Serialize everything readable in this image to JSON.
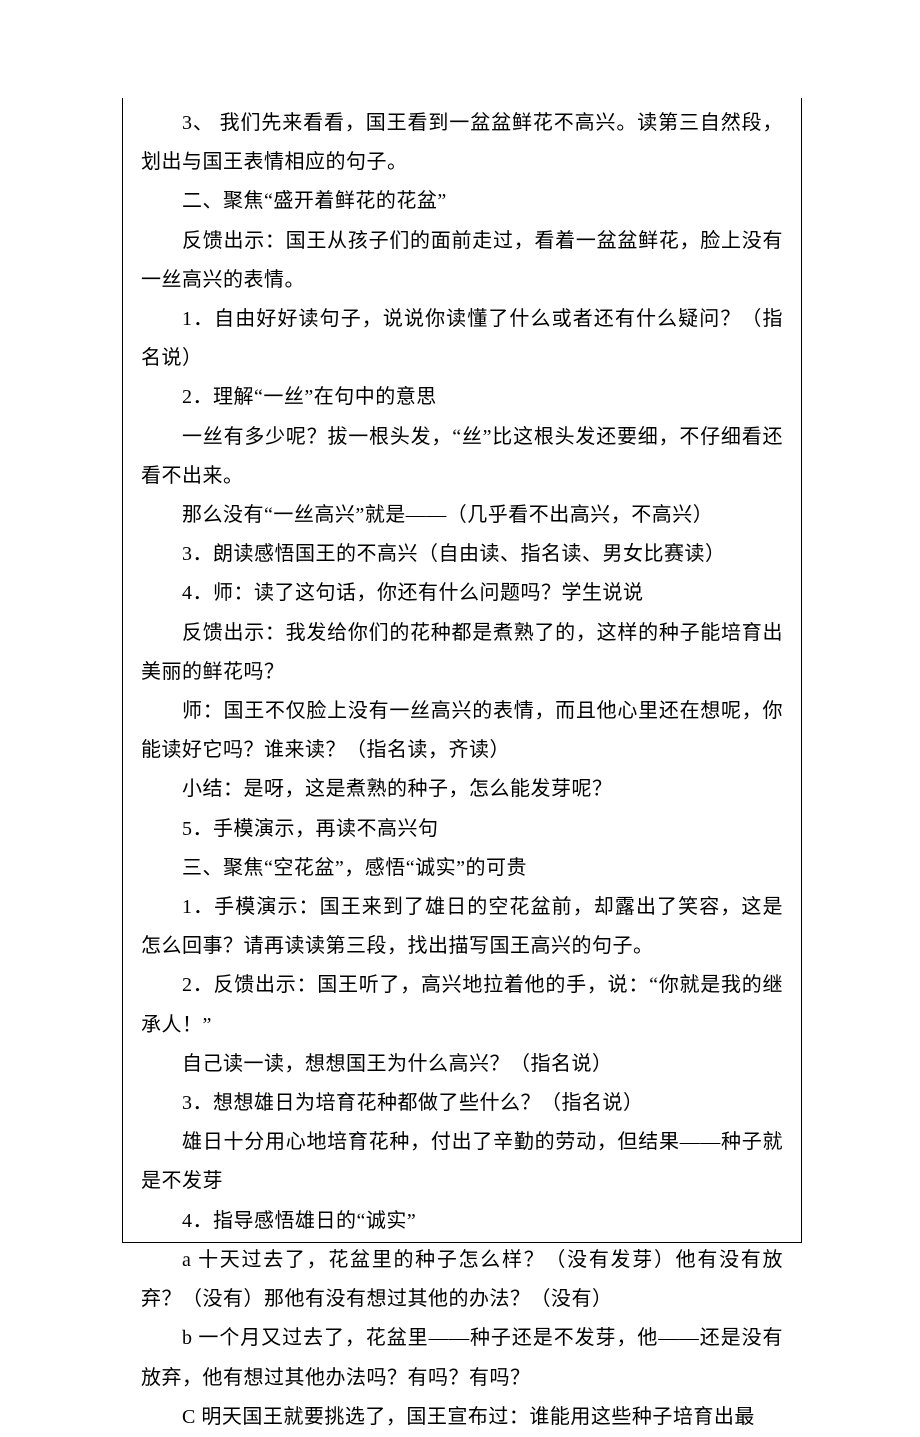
{
  "lines": [
    "3、 我们先来看看，国王看到一盆盆鲜花不高兴。读第三自然段，划出与国王表情相应的句子。",
    "二、聚焦“盛开着鲜花的花盆”",
    "反馈出示：国王从孩子们的面前走过，看着一盆盆鲜花，脸上没有一丝高兴的表情。",
    "1．自由好好读句子，说说你读懂了什么或者还有什么疑问？（指名说）",
    "2．理解“一丝”在句中的意思",
    "一丝有多少呢？拔一根头发，“丝”比这根头发还要细，不仔细看还看不出来。",
    "那么没有“一丝高兴”就是——（几乎看不出高兴，不高兴）",
    "3．朗读感悟国王的不高兴（自由读、指名读、男女比赛读）",
    "4．师：读了这句话，你还有什么问题吗？学生说说",
    "反馈出示：我发给你们的花种都是煮熟了的，这样的种子能培育出美丽的鲜花吗？",
    "师：国王不仅脸上没有一丝高兴的表情，而且他心里还在想呢，你能读好它吗？谁来读？（指名读，齐读）",
    "小结：是呀，这是煮熟的种子，怎么能发芽呢？",
    "5．手模演示，再读不高兴句",
    "三、聚焦“空花盆”，感悟“诚实”的可贵",
    "1．手模演示：国王来到了雄日的空花盆前，却露出了笑容，这是怎么回事？请再读读第三段，找出描写国王高兴的句子。",
    "2．反馈出示：国王听了，高兴地拉着他的手，说：“你就是我的继承人！”",
    "自己读一读，想想国王为什么高兴？（指名说）",
    "3．想想雄日为培育花种都做了些什么？（指名说）",
    "雄日十分用心地培育花种，付出了辛勤的劳动，但结果——种子就是不发芽",
    "4．指导感悟雄日的“诚实”",
    "a 十天过去了，花盆里的种子怎么样？（没有发芽）他有没有放弃？（没有）那他有没有想过其他的办法？（没有）",
    "b 一个月又过去了，花盆里——种子还是不发芽，他——还是没有放弃，他有想过其他办法吗？有吗？有吗？",
    "C 明天国王就要挑选了，国王宣布过：谁能用这些种子培育出最"
  ]
}
